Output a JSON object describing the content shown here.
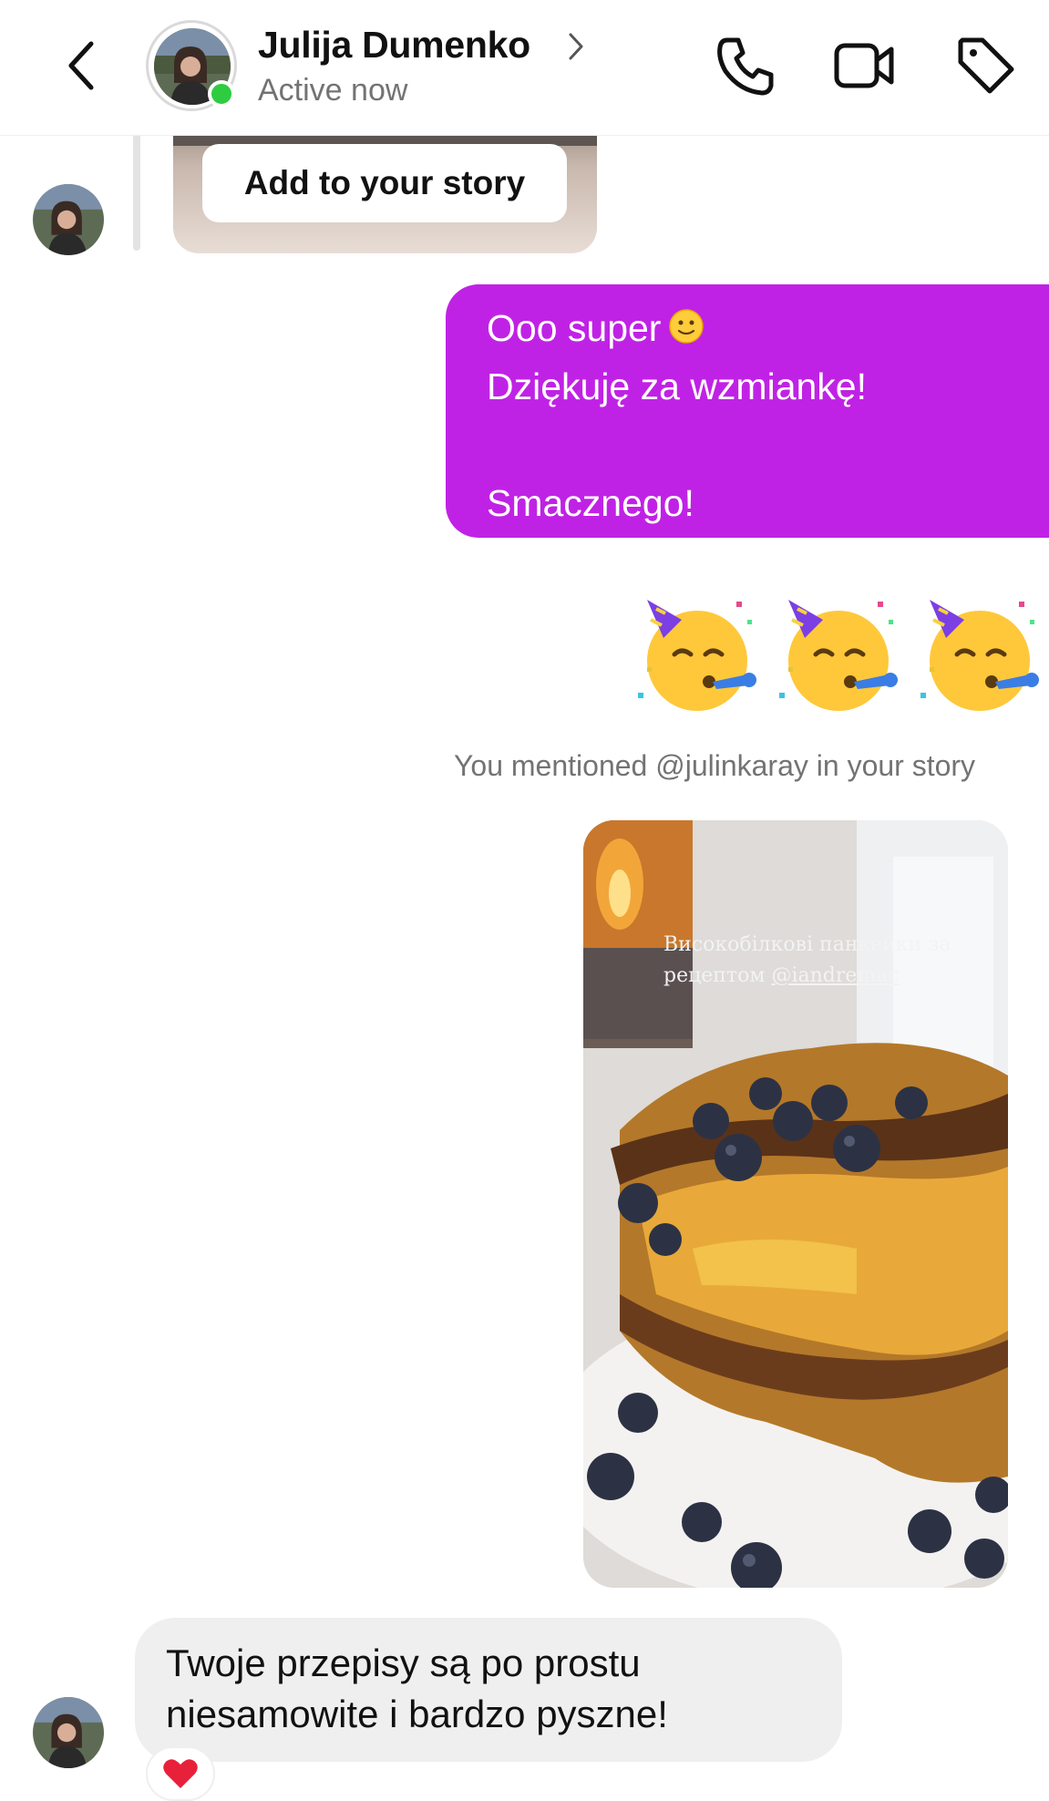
{
  "header": {
    "contact_name": "Julija Dumenko",
    "status": "Active now",
    "icons": [
      "back-icon",
      "chevron-right-icon",
      "phone-icon",
      "video-call-icon",
      "tag-icon"
    ]
  },
  "story_share": {
    "button_label": "Add to your story"
  },
  "messages": {
    "sent": {
      "line1": "Ooo super",
      "line2": "Dziękuję za wzmiankę!",
      "line3": "Smacznego!",
      "color": "#c022e5"
    },
    "party_emojis": [
      "🥳",
      "🥳",
      "🥳"
    ],
    "mention_note": "You mentioned @julinkaray in your story",
    "story_caption": {
      "text": "Високобілкові панкейки за рецептом",
      "handle": "@iandremac"
    },
    "received": {
      "line1": "Twoje przepisy są po prostu",
      "line2": "niesamowite i bardzo pyszne!",
      "reaction": "heart"
    }
  },
  "colors": {
    "online": "#2ecc40",
    "received_bubble": "#efefef",
    "muted_text": "#737373"
  }
}
